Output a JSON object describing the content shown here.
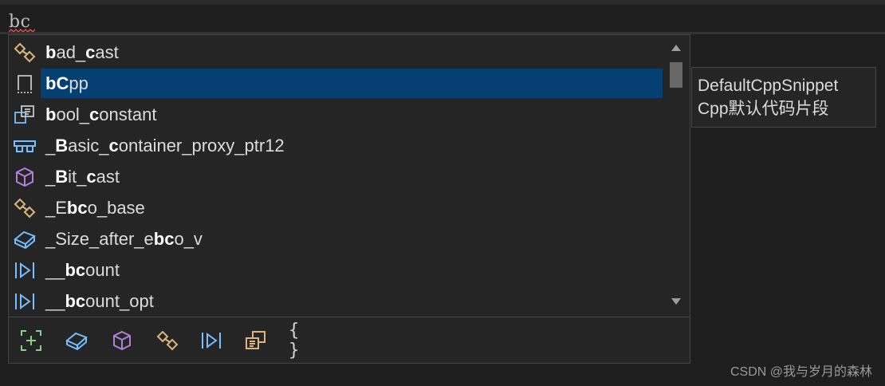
{
  "editor": {
    "typed_text": "bc"
  },
  "completion": {
    "items": [
      {
        "icon": "typedef-icon",
        "pre": "",
        "b1": "b",
        "mid": "ad_",
        "b2": "c",
        "post": "ast",
        "selected": false
      },
      {
        "icon": "snippet-icon",
        "pre": "",
        "b1": "bC",
        "mid": "pp",
        "b2": "",
        "post": "",
        "selected": true
      },
      {
        "icon": "template-icon",
        "pre": "",
        "b1": "b",
        "mid": "ool_",
        "b2": "c",
        "post": "onstant",
        "selected": false
      },
      {
        "icon": "struct-icon",
        "pre": "_",
        "b1": "B",
        "mid": "asic_",
        "b2": "c",
        "post": "ontainer_proxy_ptr12",
        "selected": false
      },
      {
        "icon": "class-icon",
        "pre": "_",
        "b1": "B",
        "mid": "it_",
        "b2": "c",
        "post": "ast",
        "selected": false
      },
      {
        "icon": "typedef-icon",
        "pre": "_E",
        "b1": "bc",
        "mid": "o_base",
        "b2": "",
        "post": "",
        "selected": false
      },
      {
        "icon": "variable-icon",
        "pre": "_Size_after_e",
        "b1": "bc",
        "mid": "o_v",
        "b2": "",
        "post": "",
        "selected": false
      },
      {
        "icon": "macro-icon",
        "pre": "__",
        "b1": "bc",
        "mid": "ount",
        "b2": "",
        "post": "",
        "selected": false
      },
      {
        "icon": "macro-icon",
        "pre": "__",
        "b1": "bc",
        "mid": "ount_opt",
        "b2": "",
        "post": "",
        "selected": false
      }
    ]
  },
  "filters": {
    "braces_label": "{ }"
  },
  "tooltip": {
    "line1": "DefaultCppSnippet",
    "line2": "Cpp默认代码片段"
  },
  "watermark": "CSDN @我与岁月的森林",
  "colors": {
    "selection": "#064073",
    "yellow_icon": "#dcb67a",
    "blue_icon": "#75beff",
    "purple_icon": "#b180d7"
  }
}
